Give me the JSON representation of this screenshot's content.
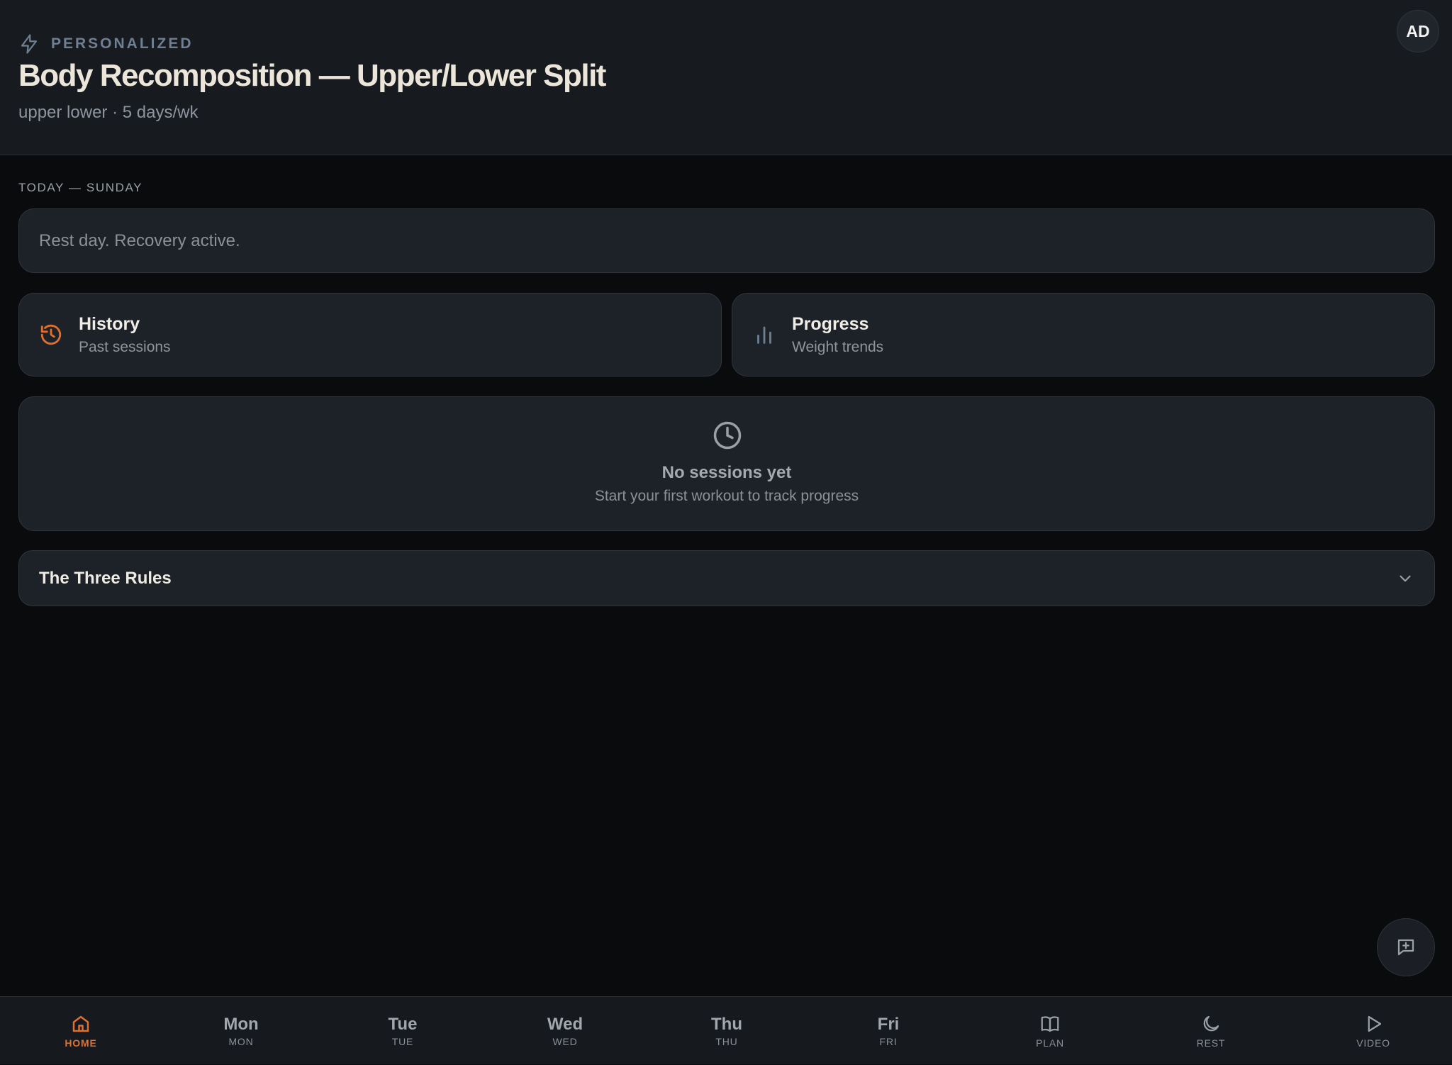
{
  "header": {
    "badge": "PERSONALIZED",
    "title": "Body Recomposition — Upper/Lower Split",
    "subtitle": "upper lower · 5 days/wk",
    "avatar_initials": "AD"
  },
  "today": {
    "label": "TODAY — SUNDAY",
    "status_text": "Rest day. Recovery active."
  },
  "tiles": {
    "history": {
      "title": "History",
      "subtitle": "Past sessions",
      "icon": "history-icon"
    },
    "progress": {
      "title": "Progress",
      "subtitle": "Weight trends",
      "icon": "bar-chart-icon"
    }
  },
  "empty_state": {
    "title": "No sessions yet",
    "subtitle": "Start your first workout to track progress",
    "icon": "clock-icon"
  },
  "rules": {
    "title": "The Three Rules",
    "expanded": false
  },
  "nav": {
    "home": "HOME",
    "days": [
      {
        "big": "Mon",
        "small": "MON"
      },
      {
        "big": "Tue",
        "small": "TUE"
      },
      {
        "big": "Wed",
        "small": "WED"
      },
      {
        "big": "Thu",
        "small": "THU"
      },
      {
        "big": "Fri",
        "small": "FRI"
      }
    ],
    "plan": "PLAN",
    "rest": "REST",
    "video": "VIDEO",
    "active": "home"
  },
  "colors": {
    "accent": "#e0702e",
    "muted_icon": "#6f7f92",
    "card_bg": "#1d2128",
    "page_bg": "#0a0b0c"
  }
}
